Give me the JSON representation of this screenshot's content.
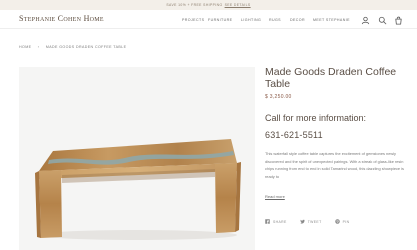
{
  "promo": {
    "text": "Save 10% + free shipping",
    "link": "see details"
  },
  "header": {
    "logo": "Stephanie Cohen Home",
    "nav": [
      "Projects",
      "Furniture",
      "Lighting",
      "Rugs",
      "Decor",
      "Meet Stephanie"
    ],
    "icons": [
      "user-icon",
      "search-icon",
      "cart-icon"
    ]
  },
  "breadcrumb": {
    "home": "Home",
    "separator": "›",
    "current": "Made Goods Draden Coffee Table"
  },
  "product": {
    "title": "Made Goods Draden Coffee Table",
    "price": "$ 3,250.00",
    "call_heading": "Call for more information:",
    "phone": "631-621-5511",
    "description": "This waterfall style coffee table captures the excitement of gemstones newly discovered and the spirit of unexpected pairings. With a streak of glass-like resin chips running from end to end in solid Tamarind wood, this dazzling showpiece is ready to",
    "read_more": "Read more"
  },
  "share": {
    "share_label": "Share",
    "tweet_label": "Tweet",
    "pin_label": "Pin"
  },
  "colors": {
    "promo_bg": "#f3efe9",
    "title": "#5a4e45",
    "price": "#8a5a48",
    "wood": "#b98a55",
    "resin": "#8fa7a8"
  }
}
